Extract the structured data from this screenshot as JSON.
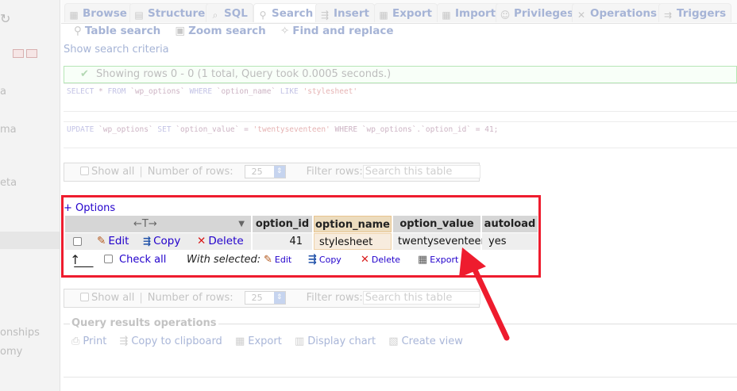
{
  "sidebar": {
    "items": [
      {
        "label": "a"
      },
      {
        "label": "ma"
      },
      {
        "label": "eta"
      },
      {
        "label": "onships"
      },
      {
        "label": "omy"
      }
    ]
  },
  "tabs": [
    {
      "label": "Browse",
      "icon": "table-icon"
    },
    {
      "label": "Structure",
      "icon": "structure-icon"
    },
    {
      "label": "SQL",
      "icon": "sql-icon"
    },
    {
      "label": "Search",
      "icon": "search-icon",
      "active": true
    },
    {
      "label": "Insert",
      "icon": "insert-icon"
    },
    {
      "label": "Export",
      "icon": "export-icon"
    },
    {
      "label": "Import",
      "icon": "import-icon"
    },
    {
      "label": "Privileges",
      "icon": "privileges-icon"
    },
    {
      "label": "Operations",
      "icon": "wrench-icon"
    },
    {
      "label": "Triggers",
      "icon": "triggers-icon"
    }
  ],
  "subnav": {
    "table_search": "Table search",
    "zoom_search": "Zoom search",
    "find_replace": "Find and replace"
  },
  "show_criteria": "Show search criteria",
  "success_message": "Showing rows 0 - 0 (1 total, Query took 0.0005 seconds.)",
  "sql_query_1": {
    "p1": "SELECT",
    "p2": " * ",
    "p3": "FROM",
    "p4": " `wp_options` ",
    "p5": "WHERE",
    "p6": " `option_name` ",
    "p7": "LIKE",
    "p8": " 'stylesheet'"
  },
  "sql_query_2": {
    "p1": "UPDATE",
    "p2": " `wp_options` ",
    "p3": "SET",
    "p4": " `option_value` = ",
    "p5": "'twentyseventeen'",
    "p6": " WHERE `wp_options`.`option_id` = 41;"
  },
  "nav_controls": {
    "show_all": "Show all",
    "separator": "|",
    "rows_label": "Number of rows:",
    "rows_value": "25",
    "filter_label": "Filter rows:",
    "filter_placeholder": "Search this table"
  },
  "options_link": "+ Options",
  "table": {
    "lr_toggle": "←T→",
    "columns": [
      "option_id",
      "option_name",
      "option_value",
      "autoload"
    ],
    "row": {
      "edit": "Edit",
      "copy": "Copy",
      "delete": "Delete",
      "option_id": "41",
      "option_name": "stylesheet",
      "option_value": "twentyseventeen",
      "autoload": "yes"
    }
  },
  "bulk": {
    "check_all": "Check all",
    "with_selected": "With selected:",
    "edit": "Edit",
    "copy": "Copy",
    "delete": "Delete",
    "export": "Export"
  },
  "query_results": {
    "legend": "Query results operations",
    "print": "Print",
    "copy_clipboard": "Copy to clipboard",
    "export": "Export",
    "display_chart": "Display chart",
    "create_view": "Create view"
  },
  "colors": {
    "highlight_box": "#ee1c2e",
    "link": "#2200cc"
  }
}
